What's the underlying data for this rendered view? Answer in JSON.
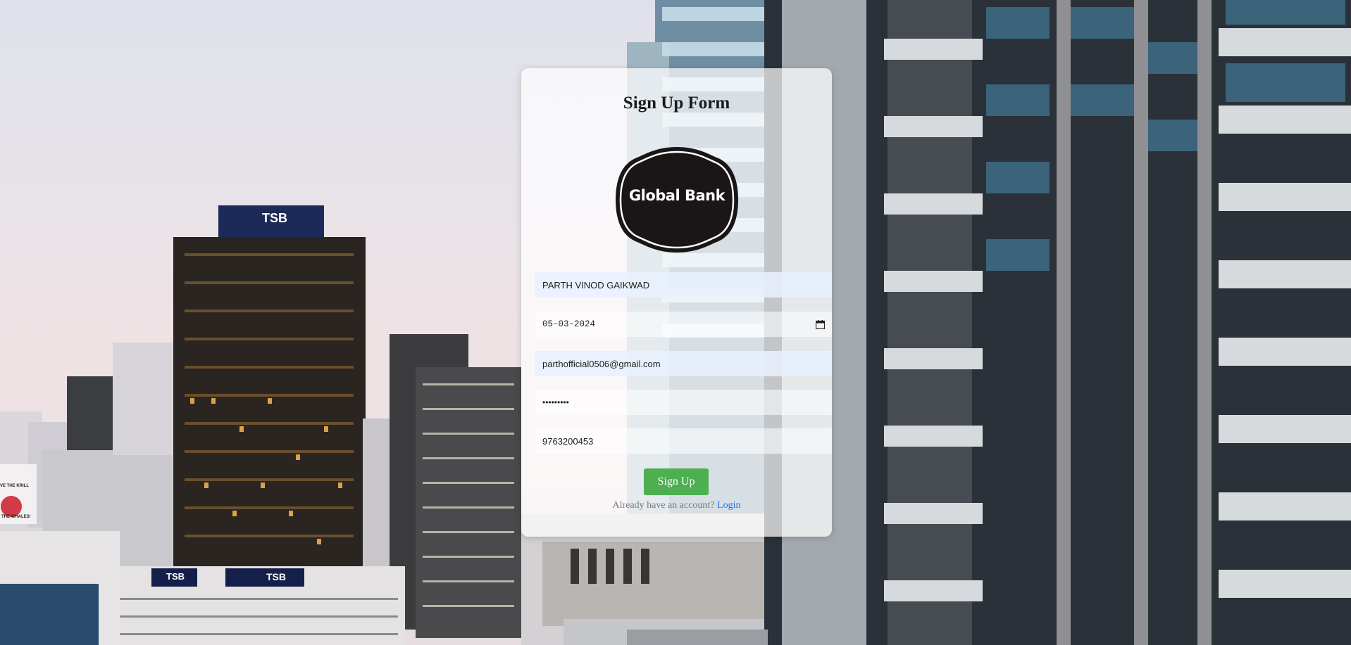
{
  "form": {
    "title": "Sign Up Form",
    "logo_text": "Global Bank",
    "name_value": "PARTH VINOD GAIKWAD",
    "date_value": "05-03-2024",
    "email_value": "parthofficial0506@gmail.com",
    "password_mask": "•••••••••",
    "phone_value": "9763200453",
    "submit_label": "Sign Up",
    "login_prompt": "Already have an account?",
    "login_link": "Login"
  },
  "background": {
    "signs": [
      "TSB",
      "TSB",
      "TSB"
    ],
    "poster_text": [
      "VE THE KRILL",
      "THE WHALES!"
    ]
  },
  "colors": {
    "button": "#4caf50",
    "link": "#1a73e8",
    "autofill": "#e8f0fe",
    "logo_badge": "#1a1617"
  }
}
